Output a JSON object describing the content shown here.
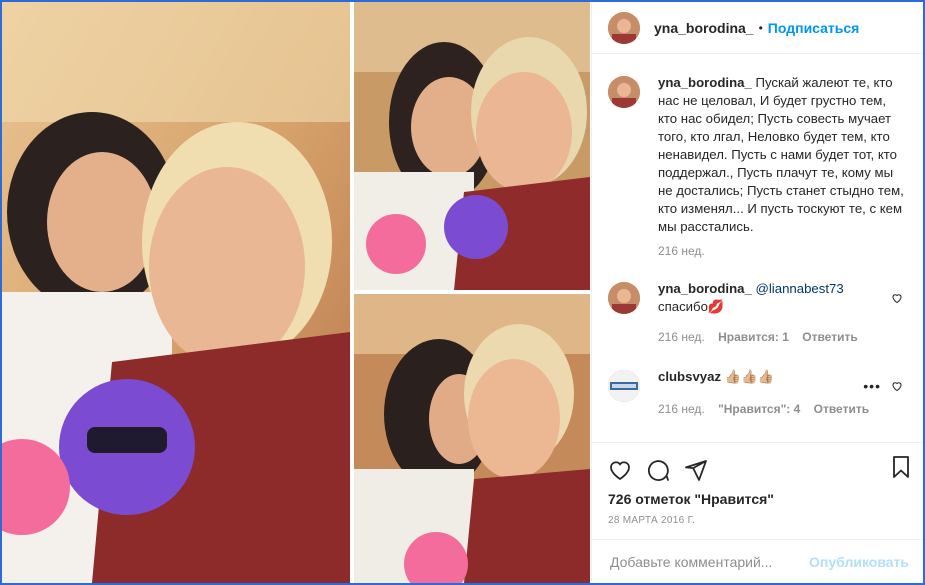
{
  "header": {
    "username": "yna_borodina_",
    "separator": "•",
    "follow_label": "Подписаться"
  },
  "caption": {
    "username": "yna_borodina_",
    "text": "Пускай жалеют те, кто нас не целовал, И будет грустно тем, кто нас обидел; Пусть совесть мучает того, кто лгал, Неловко будет тем, кто ненавидел. Пусть с нами будет тот, кто поддержал., Пусть плачут те, кому мы не достались; Пусть станет стыдно тем, кто изменял... И пусть тоскуют те, с кем мы расстались.",
    "time": "216 нед."
  },
  "comments": [
    {
      "username": "yna_borodina_",
      "mention": "@liannabest73",
      "text": "спасибо💋",
      "time": "216 нед.",
      "likes": "Нравится: 1",
      "reply": "Ответить"
    },
    {
      "username": "clubsvyaz",
      "text": "👍🏼👍🏼👍🏼",
      "time": "216 нед.",
      "likes": "\"Нравится\": 4",
      "reply": "Ответить",
      "more": "•••"
    }
  ],
  "actions": {
    "icons": [
      "heart-icon",
      "comment-icon",
      "share-icon",
      "bookmark-icon"
    ],
    "likes_text": "726 отметок \"Нравится\"",
    "date": "28 МАРТА 2016 Г."
  },
  "add_comment": {
    "placeholder": "Добавьте комментарий...",
    "publish_label": "Опубликовать"
  },
  "colors": {
    "accent": "#0095f6",
    "publish_disabled": "#b2dffc",
    "frame": "#2d6bd6"
  }
}
